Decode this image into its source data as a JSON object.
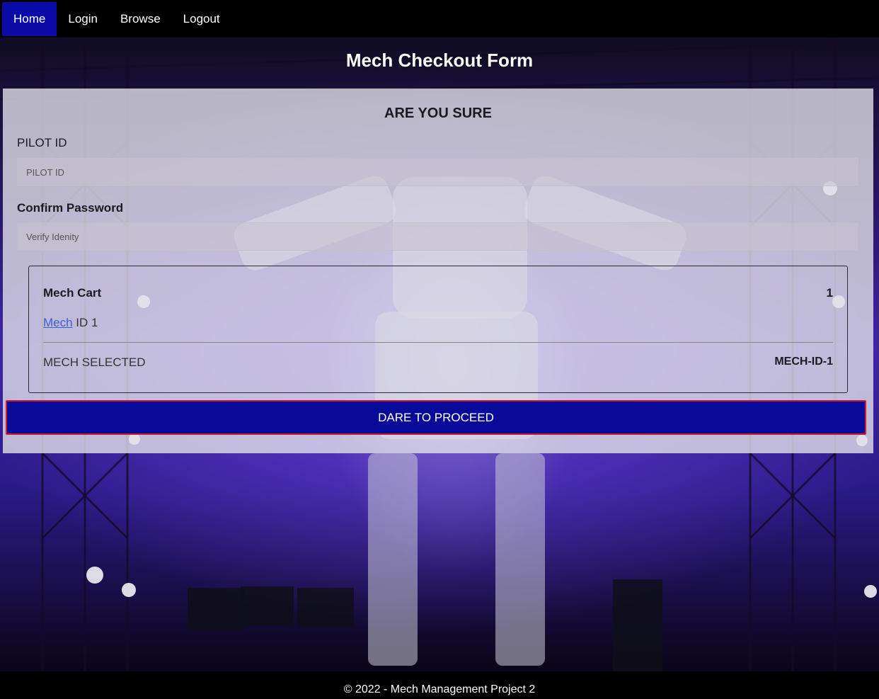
{
  "nav": {
    "items": [
      {
        "label": "Home",
        "active": true
      },
      {
        "label": "Login",
        "active": false
      },
      {
        "label": "Browse",
        "active": false
      },
      {
        "label": "Logout",
        "active": false
      }
    ]
  },
  "page": {
    "title": "Mech Checkout Form"
  },
  "form": {
    "heading": "ARE YOU SURE",
    "pilot_label": "PILOT ID",
    "pilot_placeholder": "PILOT ID",
    "pilot_value": "",
    "password_label": "Confirm Password",
    "password_placeholder": "Verify Idenity",
    "password_value": ""
  },
  "cart": {
    "title": "Mech Cart",
    "count": "1",
    "item_link": "Mech",
    "item_text": " ID 1",
    "selected_label": "MECH SELECTED",
    "selected_value": "MECH-ID-1"
  },
  "actions": {
    "proceed_label": "DARE TO PROCEED"
  },
  "footer": {
    "text": "© 2022 - Mech Management Project 2"
  },
  "colors": {
    "nav_active": "#0a0aa8",
    "button_bg": "#0a0a9a",
    "button_border": "#d01a2a",
    "link": "#3a5fd0"
  }
}
